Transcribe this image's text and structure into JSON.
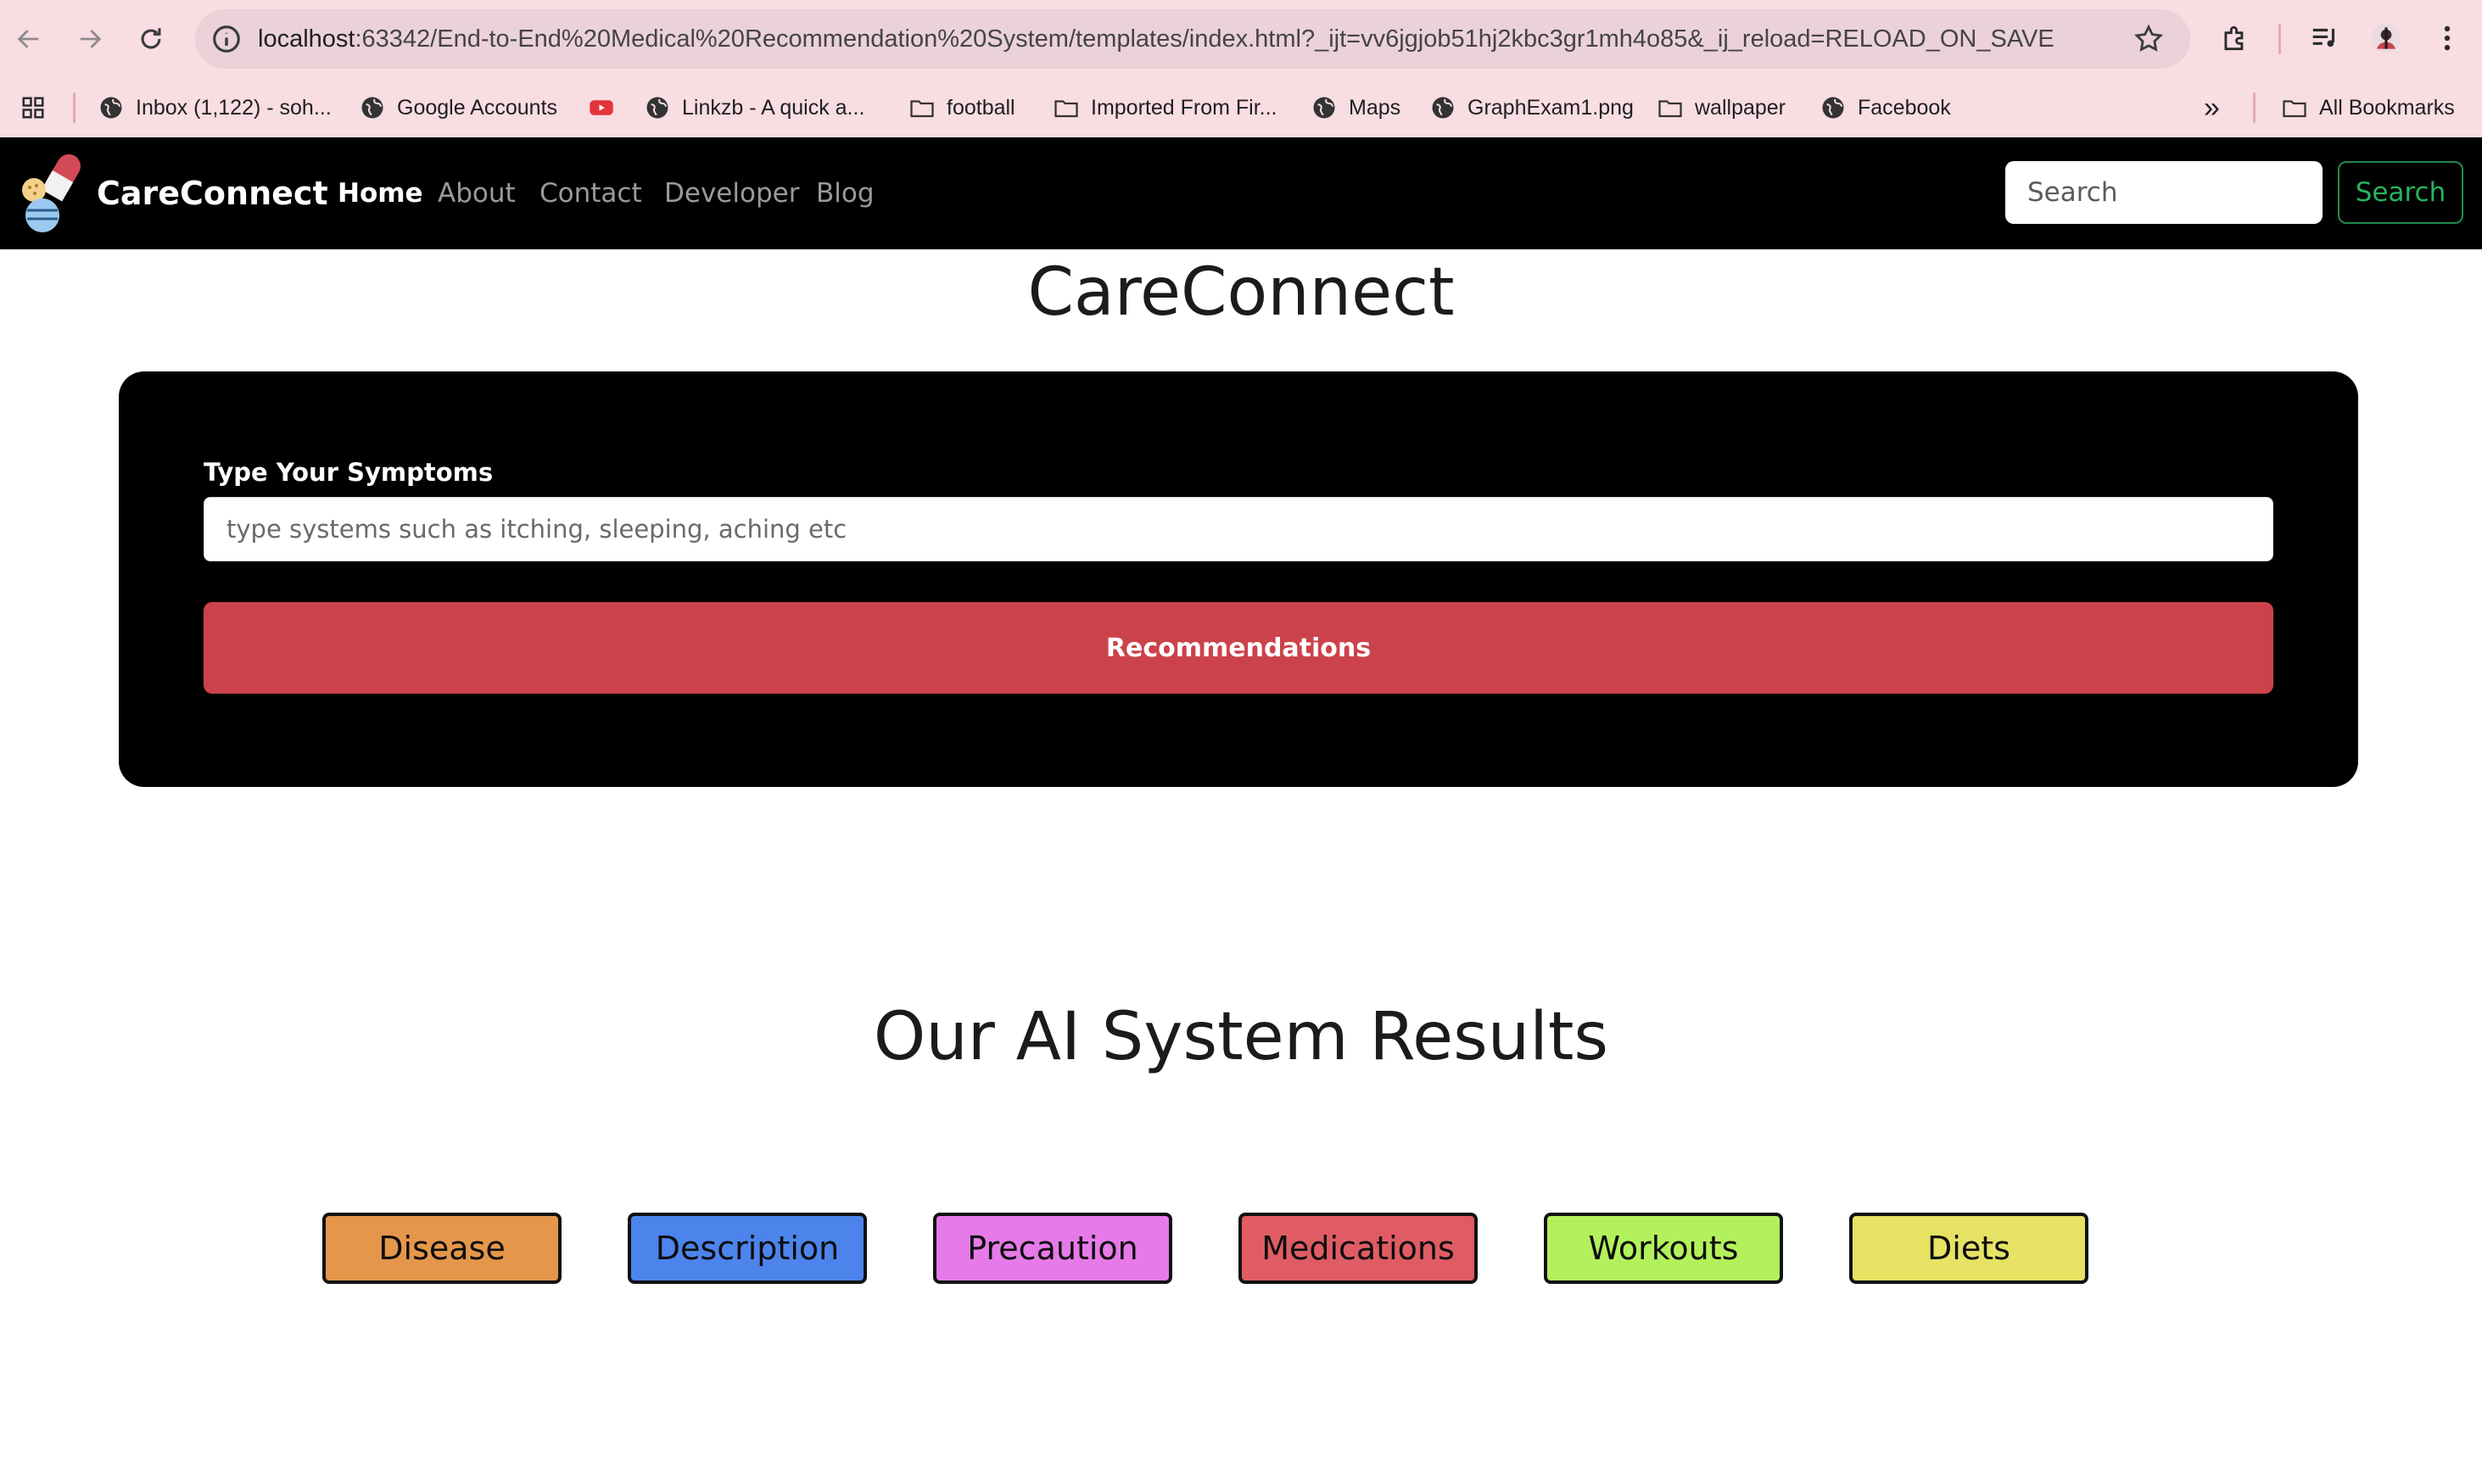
{
  "browser": {
    "url_host": "localhost",
    "url_rest": ":63342/End-to-End%20Medical%20Recommendation%20System/templates/index.html?_ijt=vv6jgjob51hj2kbc3gr1mh4o85&_ij_reload=RELOAD_ON_SAVE",
    "bookmarks": [
      {
        "label": "Inbox (1,122) - soh...",
        "icon": "globe-icon"
      },
      {
        "label": "Google Accounts",
        "icon": "globe-icon"
      },
      {
        "label": "",
        "icon": "youtube-icon"
      },
      {
        "label": "Linkzb - A quick a...",
        "icon": "globe-icon"
      },
      {
        "label": "football",
        "icon": "folder-icon"
      },
      {
        "label": "Imported From Fir...",
        "icon": "folder-icon"
      },
      {
        "label": "Maps",
        "icon": "globe-icon"
      },
      {
        "label": "GraphExam1.png",
        "icon": "globe-icon"
      },
      {
        "label": "wallpaper",
        "icon": "folder-icon"
      },
      {
        "label": "Facebook",
        "icon": "globe-icon"
      }
    ],
    "overflow_label": "»",
    "all_bookmarks_label": "All Bookmarks"
  },
  "site": {
    "brand": "CareConnect",
    "nav": [
      {
        "label": "Home",
        "active": true
      },
      {
        "label": "About",
        "active": false
      },
      {
        "label": "Contact",
        "active": false
      },
      {
        "label": "Developer",
        "active": false
      },
      {
        "label": "Blog",
        "active": false
      }
    ],
    "search": {
      "placeholder": "Search",
      "button_label": "Search"
    }
  },
  "main": {
    "title": "CareConnect",
    "form": {
      "label": "Type Your Symptoms",
      "placeholder": "type systems such as itching, sleeping, aching etc",
      "button_label": "Recommendations"
    },
    "results_title": "Our AI System Results",
    "results": [
      {
        "label": "Disease",
        "color": "#e4974a"
      },
      {
        "label": "Description",
        "color": "#4c84ec"
      },
      {
        "label": "Precaution",
        "color": "#e67ae8"
      },
      {
        "label": "Medications",
        "color": "#e05c64"
      },
      {
        "label": "Workouts",
        "color": "#b3f15c"
      },
      {
        "label": "Diets",
        "color": "#e6e264"
      }
    ]
  }
}
